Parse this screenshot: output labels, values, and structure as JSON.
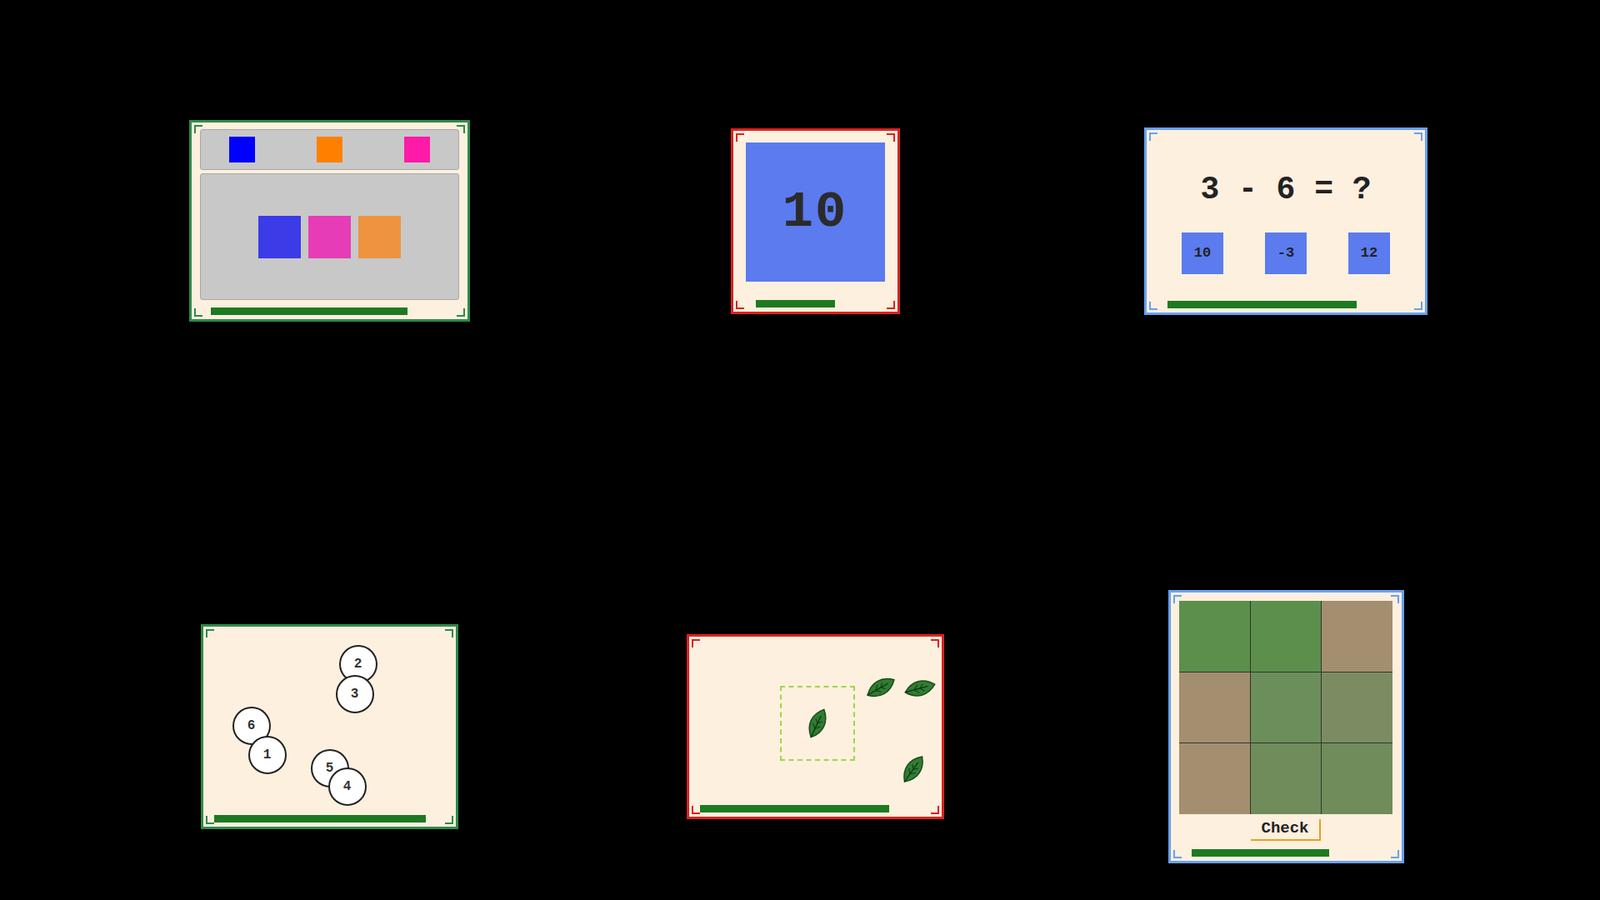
{
  "cards": [
    {
      "kind": "color-match",
      "color": "#2e8b4a",
      "level": 0.83,
      "targets": [
        {
          "color": "#0000ff"
        },
        {
          "color": "#ff8000"
        },
        {
          "color": "#ff1aa8"
        }
      ],
      "tiles": [
        {
          "color": "#3b3be8"
        },
        {
          "color": "#e63cb8"
        },
        {
          "color": "#ee9440"
        }
      ]
    },
    {
      "kind": "countdown",
      "color": "#e02020",
      "level": 0.67,
      "value": "10"
    },
    {
      "kind": "math",
      "color": "#6aa0f0",
      "level": 0.8,
      "question": "3 - 6 = ?",
      "options": [
        {
          "label": "10",
          "selected": false
        },
        {
          "label": "-3",
          "selected": false
        },
        {
          "label": "12",
          "selected": false
        }
      ]
    },
    {
      "kind": "number-order",
      "color": "#2e8b4a",
      "level": 0.92,
      "bubbles": [
        {
          "label": "2"
        },
        {
          "label": "3"
        },
        {
          "label": "6"
        },
        {
          "label": "1"
        },
        {
          "label": "5"
        },
        {
          "label": "4"
        }
      ]
    },
    {
      "kind": "leaf-drag",
      "color": "#e02020",
      "level": 0.82,
      "leaves": [
        {
          "placed": true
        },
        {
          "placed": false
        },
        {
          "placed": false
        },
        {
          "placed": false
        }
      ]
    },
    {
      "kind": "image-puzzle",
      "color": "#6aa0f0",
      "level": 0.73,
      "button": "Check"
    }
  ]
}
